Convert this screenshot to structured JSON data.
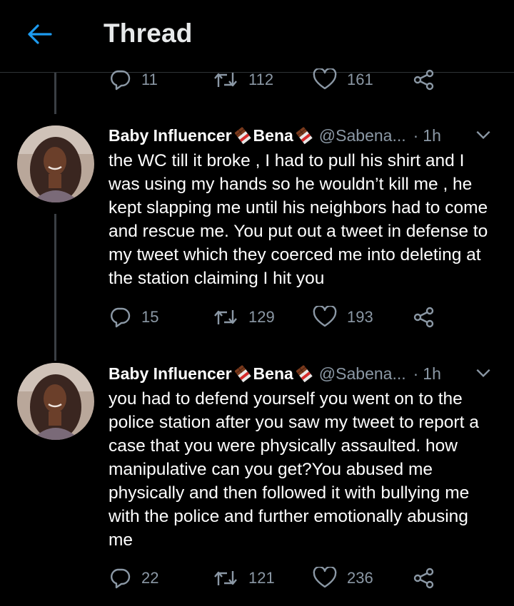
{
  "header": {
    "title": "Thread"
  },
  "top_actions": {
    "replies": "11",
    "retweets": "112",
    "likes": "161"
  },
  "tweets": [
    {
      "name": "Baby Influencer",
      "name_suffix": "Bena",
      "handle": "@Sabena...",
      "time": "1h",
      "text": "the WC till it broke , I had to pull his shirt and I\nwas using my hands so he wouldn’t kill me , he\nkept slapping me until his neighbors had to come\nand rescue me. You put out a tweet in defense to\nmy tweet which they coerced me into deleting at\nthe station claiming I hit you",
      "replies": "15",
      "retweets": "129",
      "likes": "193"
    },
    {
      "name": "Baby Influencer",
      "name_suffix": "Bena",
      "handle": "@Sabena...",
      "time": "1h",
      "text": "you had to defend yourself you went on to the\npolice station after you saw my tweet to report a\ncase that you were physically assaulted. how\nmanipulative can you get?You abused me\nphysically and then followed it with bullying me\nwith the police and further emotionally abusing\nme",
      "replies": "22",
      "retweets": "121",
      "likes": "236"
    }
  ],
  "colors": {
    "accent": "#1d9bf0",
    "muted": "#8b98a5",
    "background": "#000000"
  },
  "icons": [
    "back-arrow-icon",
    "reply-icon",
    "retweet-icon",
    "like-icon",
    "share-icon",
    "chocolate-emoji-icon",
    "chevron-down-icon"
  ]
}
